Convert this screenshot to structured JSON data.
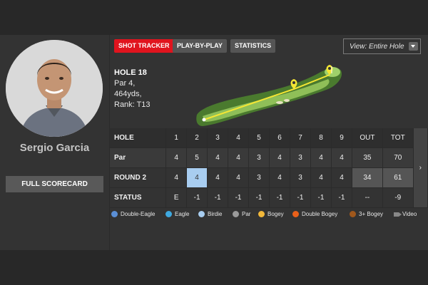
{
  "player": {
    "name": "Sergio Garcia",
    "button_label": "FULL SCORECARD"
  },
  "tabs": [
    {
      "label": "SHOT TRACKER",
      "active": true,
      "color": "#e0141e"
    },
    {
      "label": "PLAY-BY-PLAY",
      "active": false
    },
    {
      "label": "STATISTICS",
      "active": false
    }
  ],
  "view_select": {
    "value": "View: Entire Hole"
  },
  "hole": {
    "title": "HOLE 18",
    "par": "Par 4,",
    "yards": "464yds,",
    "rank": "Rank: T13"
  },
  "scorecard": {
    "header": [
      "HOLE",
      "1",
      "2",
      "3",
      "4",
      "5",
      "6",
      "7",
      "8",
      "9",
      "OUT",
      "TOT"
    ],
    "par": [
      "Par",
      "4",
      "5",
      "4",
      "4",
      "3",
      "4",
      "3",
      "4",
      "4",
      "35",
      "70"
    ],
    "round": [
      "ROUND 2",
      "4",
      "4",
      "4",
      "4",
      "3",
      "4",
      "3",
      "4",
      "4",
      "34",
      "61"
    ],
    "status": [
      "STATUS",
      "E",
      "-1",
      "-1",
      "-1",
      "-1",
      "-1",
      "-1",
      "-1",
      "-1",
      "--",
      "-9"
    ],
    "highlight_hole": "2"
  },
  "legend": [
    {
      "label": "Double-Eagle",
      "icon": "circle",
      "color": "#5b8fd6"
    },
    {
      "label": "Eagle",
      "icon": "circle",
      "color": "#3fa9e0"
    },
    {
      "label": "Birdie",
      "icon": "circle",
      "color": "#a8cdf0"
    },
    {
      "label": "Par",
      "icon": "circle",
      "color": "#9a9a9a"
    },
    {
      "label": "Bogey",
      "icon": "circle",
      "color": "#f2b83a"
    },
    {
      "label": "Double Bogey",
      "icon": "circle",
      "color": "#e9601a"
    },
    {
      "label": "3+ Bogey",
      "icon": "circle",
      "color": "#a0581c"
    },
    {
      "label": "Video",
      "icon": "video-camera-icon",
      "color": "#888888"
    }
  ]
}
